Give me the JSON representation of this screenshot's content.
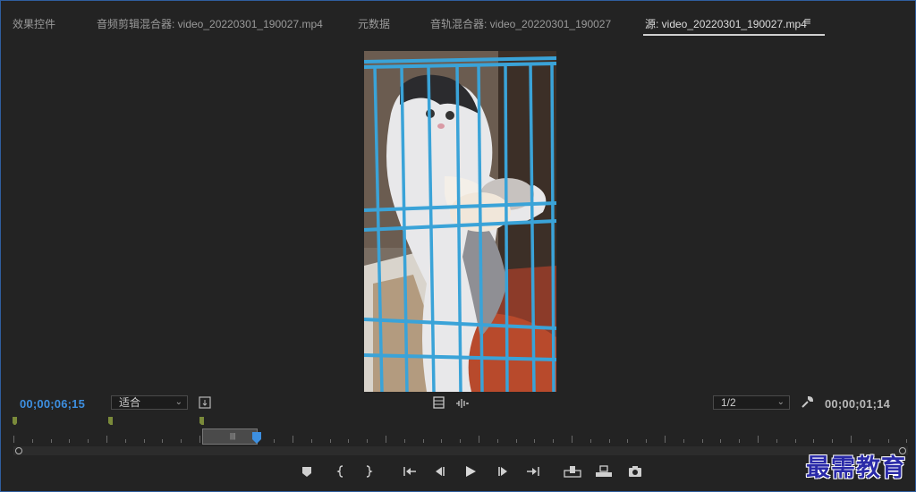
{
  "tabs": [
    {
      "label": "效果控件",
      "active": false
    },
    {
      "label": "音频剪辑混合器: video_20220301_190027.mp4",
      "active": false
    },
    {
      "label": "元数据",
      "active": false
    },
    {
      "label": "音轨混合器: video_20220301_190027",
      "active": false
    },
    {
      "label": "源: video_20220301_190027.mp4",
      "active": true
    }
  ],
  "panel_menu_icon": "hamburger-icon",
  "source_monitor": {
    "playhead_timecode": "00;00;06;15",
    "duration_timecode": "00;00;01;14",
    "zoom_select": {
      "value": "适合"
    },
    "resolution_select": {
      "value": "1/2"
    },
    "preview_content": "cat-in-blue-cage-video-frame"
  },
  "transport_buttons": [
    {
      "name": "add-marker-icon"
    },
    {
      "name": "mark-in-icon"
    },
    {
      "name": "mark-out-icon"
    },
    {
      "name": "go-to-in-icon"
    },
    {
      "name": "step-back-icon"
    },
    {
      "name": "play-icon"
    },
    {
      "name": "step-forward-icon"
    },
    {
      "name": "go-to-out-icon"
    },
    {
      "name": "insert-icon"
    },
    {
      "name": "overwrite-icon"
    },
    {
      "name": "export-frame-icon"
    }
  ],
  "colors": {
    "accent_blue": "#3d8fe0",
    "marker_green": "#7a8a3a",
    "frame_border": "#2f5e9e"
  },
  "watermark": {
    "text": "最需教育"
  }
}
